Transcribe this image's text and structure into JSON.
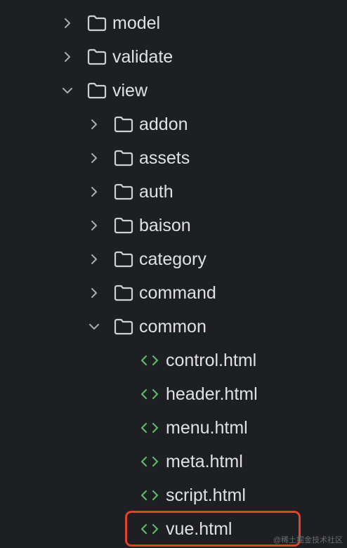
{
  "tree": {
    "rows": [
      {
        "label": "model",
        "type": "folder",
        "expanded": false,
        "depth": 0
      },
      {
        "label": "validate",
        "type": "folder",
        "expanded": false,
        "depth": 0
      },
      {
        "label": "view",
        "type": "folder",
        "expanded": true,
        "depth": 0
      },
      {
        "label": "addon",
        "type": "folder",
        "expanded": false,
        "depth": 1
      },
      {
        "label": "assets",
        "type": "folder",
        "expanded": false,
        "depth": 1
      },
      {
        "label": "auth",
        "type": "folder",
        "expanded": false,
        "depth": 1
      },
      {
        "label": "baison",
        "type": "folder",
        "expanded": false,
        "depth": 1
      },
      {
        "label": "category",
        "type": "folder",
        "expanded": false,
        "depth": 1
      },
      {
        "label": "command",
        "type": "folder",
        "expanded": false,
        "depth": 1
      },
      {
        "label": "common",
        "type": "folder",
        "expanded": true,
        "depth": 1
      },
      {
        "label": "control.html",
        "type": "file",
        "depth": 2
      },
      {
        "label": "header.html",
        "type": "file",
        "depth": 2
      },
      {
        "label": "menu.html",
        "type": "file",
        "depth": 2
      },
      {
        "label": "meta.html",
        "type": "file",
        "depth": 2
      },
      {
        "label": "script.html",
        "type": "file",
        "depth": 2
      },
      {
        "label": "vue.html",
        "type": "file",
        "depth": 2,
        "highlighted": true
      }
    ]
  },
  "watermark": "@稀土掘金技术社区",
  "colors": {
    "background": "#1e1f22",
    "text": "#dfe1e5",
    "chevron": "#a9abb0",
    "folder_outline": "#ced0d6",
    "html_icon": "#5fb865",
    "highlight_border": "#e0442b"
  },
  "icons": {
    "collapsed": "chevron-right-icon",
    "expanded": "chevron-down-icon",
    "folder": "folder-icon",
    "file": "html-file-icon"
  }
}
